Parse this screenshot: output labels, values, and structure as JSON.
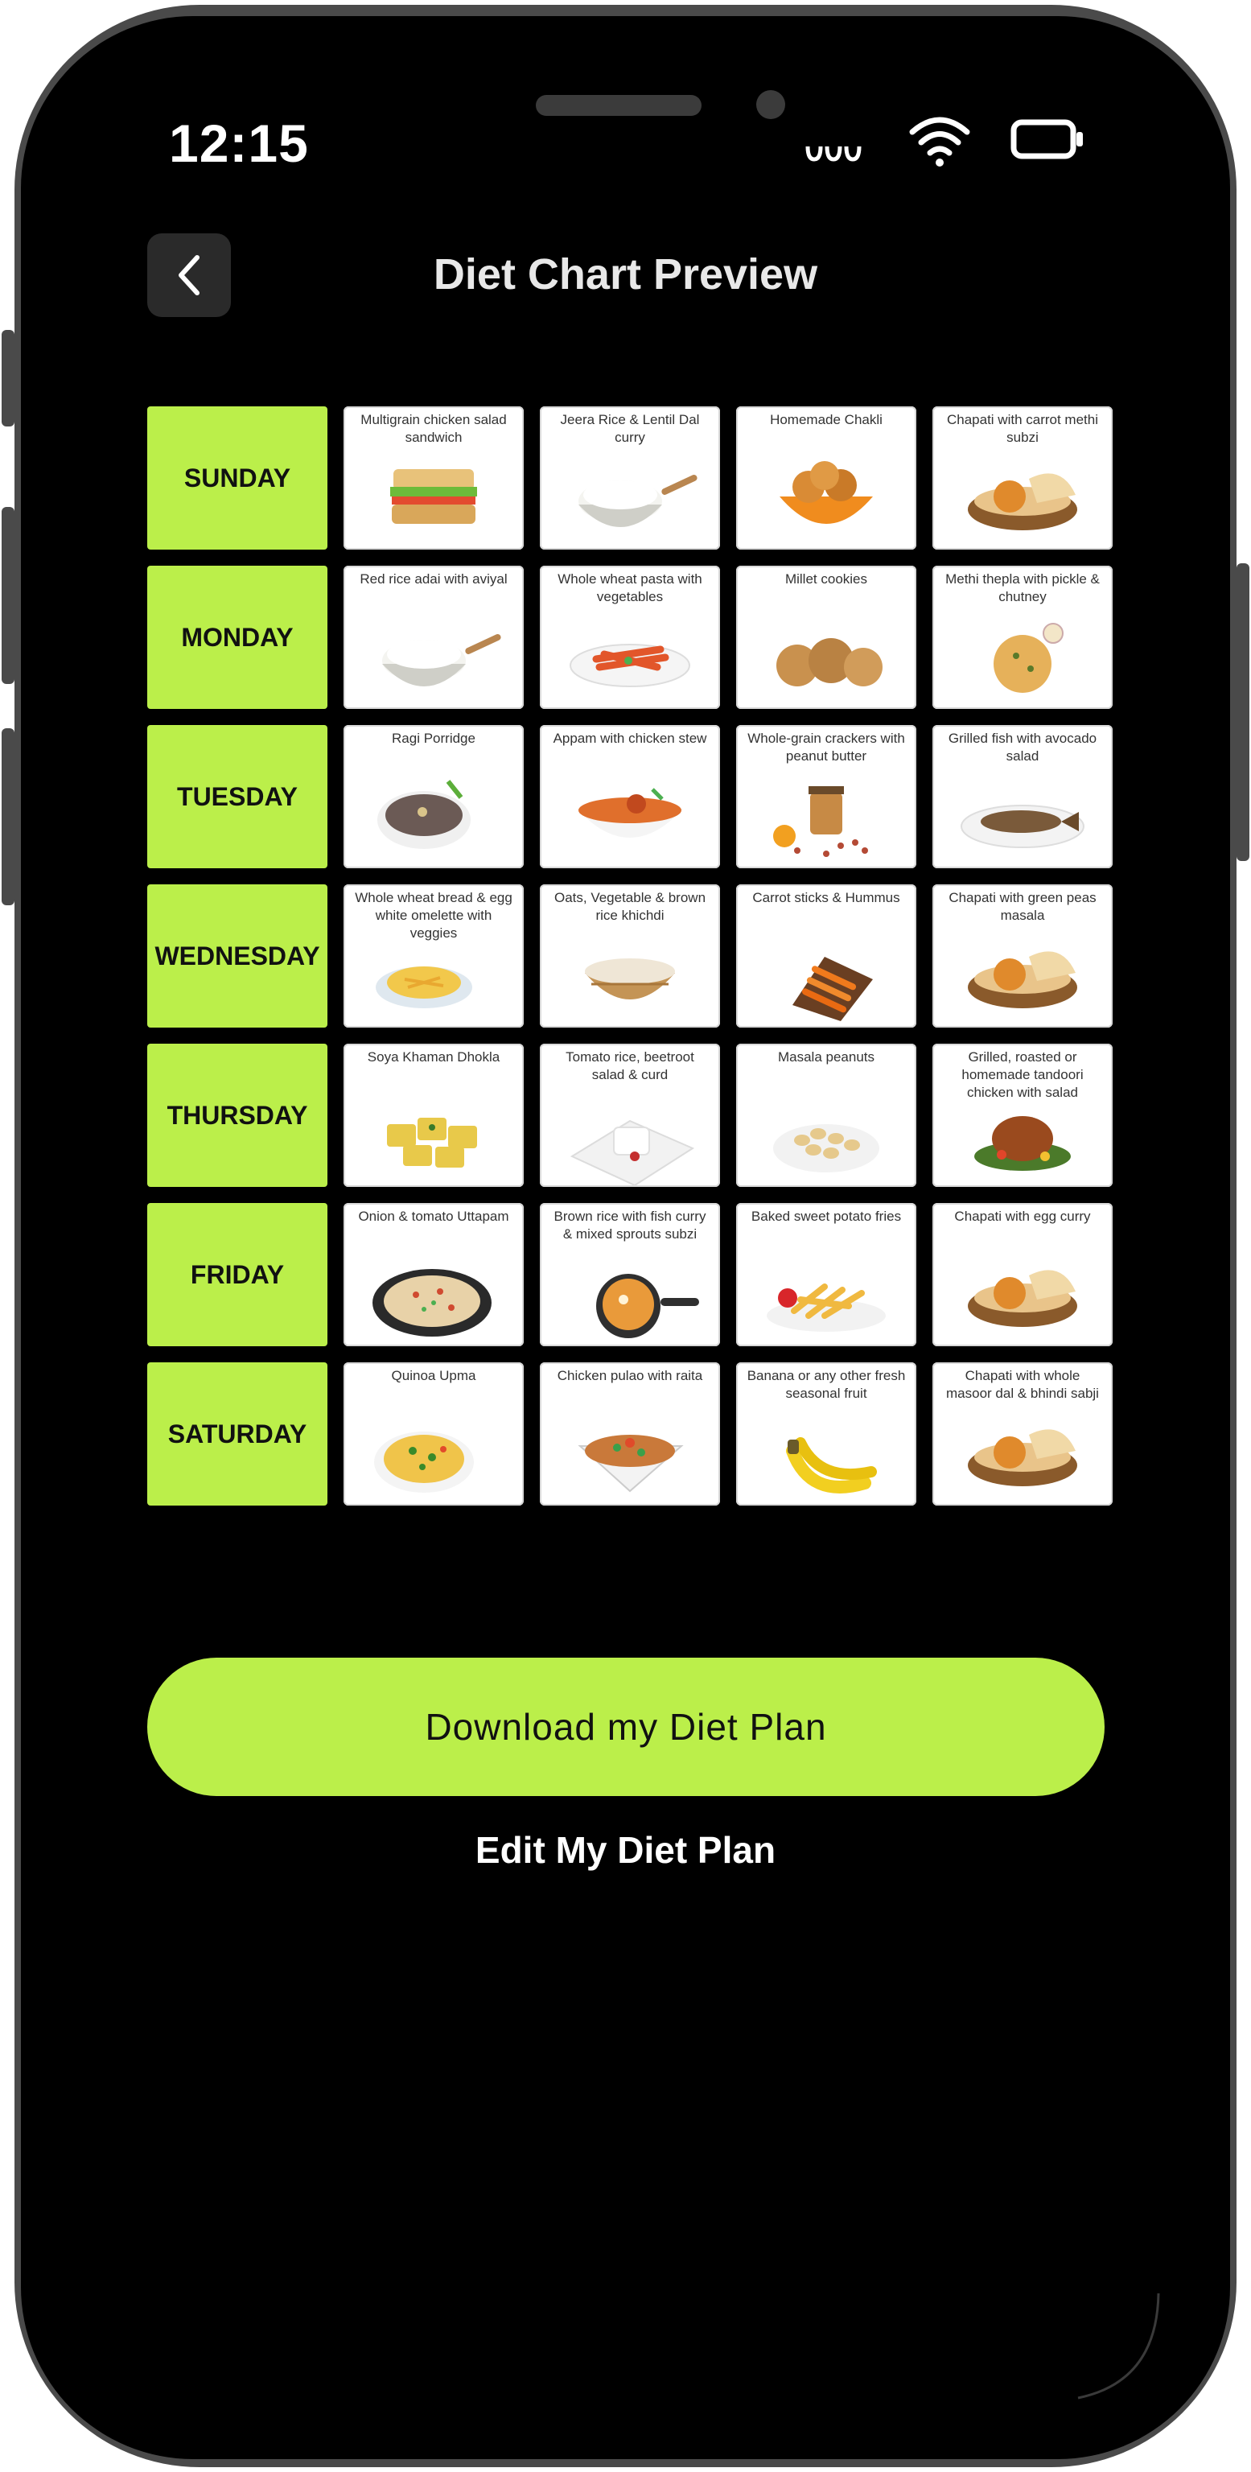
{
  "status_bar": {
    "time": "12:15"
  },
  "header": {
    "title": "Diet Chart Preview"
  },
  "colors": {
    "accent": "#bbef4a",
    "background": "#000000",
    "phone_frame": "#4a4a4a"
  },
  "diet_chart": [
    {
      "day": "SUNDAY",
      "meals": [
        {
          "name": "Multigrain chicken salad sandwich",
          "icon": "sandwich"
        },
        {
          "name": "Jeera Rice & Lentil Dal curry",
          "icon": "rice-bowl"
        },
        {
          "name": "Homemade Chakli",
          "icon": "chakli"
        },
        {
          "name": "Chapati with carrot methi subzi",
          "icon": "chapati-basket"
        }
      ]
    },
    {
      "day": "MONDAY",
      "meals": [
        {
          "name": "Red rice adai with aviyal",
          "icon": "rice-bowl"
        },
        {
          "name": "Whole wheat pasta with vegetables",
          "icon": "pasta"
        },
        {
          "name": "Millet cookies",
          "icon": "cookies"
        },
        {
          "name": "Methi thepla with pickle & chutney",
          "icon": "thepla"
        }
      ]
    },
    {
      "day": "TUESDAY",
      "meals": [
        {
          "name": "Ragi Porridge",
          "icon": "porridge"
        },
        {
          "name": "Appam with chicken stew",
          "icon": "curry-bowl"
        },
        {
          "name": "Whole-grain crackers with peanut butter",
          "icon": "peanut-butter"
        },
        {
          "name": "Grilled fish with avocado salad",
          "icon": "grilled-fish"
        }
      ]
    },
    {
      "day": "WEDNESDAY",
      "meals": [
        {
          "name": "Whole wheat bread & egg white omelette with veggies",
          "icon": "omelette"
        },
        {
          "name": "Oats, Vegetable & brown rice khichdi",
          "icon": "khichdi"
        },
        {
          "name": "Carrot sticks & Hummus",
          "icon": "carrot-sticks"
        },
        {
          "name": "Chapati with green peas masala",
          "icon": "chapati-basket"
        }
      ]
    },
    {
      "day": "THURSDAY",
      "meals": [
        {
          "name": "Soya Khaman Dhokla",
          "icon": "dhokla"
        },
        {
          "name": "Tomato rice, beetroot salad & curd",
          "icon": "curd-plate"
        },
        {
          "name": "Masala peanuts",
          "icon": "peanuts"
        },
        {
          "name": "Grilled, roasted or homemade tandoori chicken with salad",
          "icon": "tandoori-chicken"
        }
      ]
    },
    {
      "day": "FRIDAY",
      "meals": [
        {
          "name": "Onion & tomato Uttapam",
          "icon": "uttapam"
        },
        {
          "name": "Brown rice with fish curry & mixed sprouts subzi",
          "icon": "curry-pan"
        },
        {
          "name": "Baked sweet potato fries",
          "icon": "fries"
        },
        {
          "name": "Chapati with egg curry",
          "icon": "chapati-basket"
        }
      ]
    },
    {
      "day": "SATURDAY",
      "meals": [
        {
          "name": "Quinoa Upma",
          "icon": "upma"
        },
        {
          "name": "Chicken pulao with raita",
          "icon": "pulao"
        },
        {
          "name": "Banana or any other fresh seasonal fruit",
          "icon": "banana"
        },
        {
          "name": "Chapati with whole masoor dal & bhindi sabji",
          "icon": "chapati-basket"
        }
      ]
    }
  ],
  "actions": {
    "download_label": "Download my Diet Plan",
    "edit_label": "Edit My Diet Plan"
  }
}
